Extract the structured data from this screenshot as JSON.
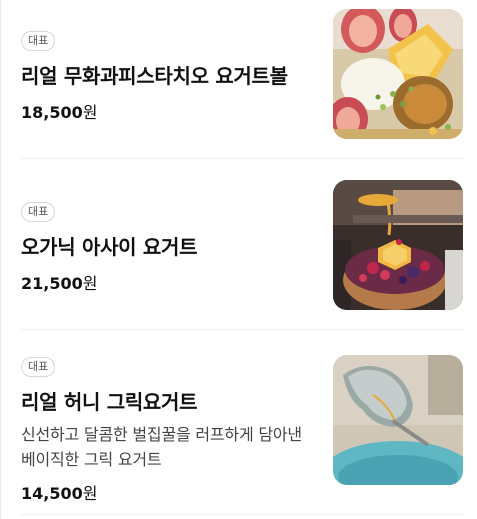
{
  "items": [
    {
      "badge": "대표",
      "name": "리얼 무화과피스타치오 요거트볼",
      "description": "",
      "price": "18,500",
      "currency": "원",
      "image_icon": "fig-pistachio-yogurt-bowl-photo"
    },
    {
      "badge": "대표",
      "name": "오가닉 아사이 요거트",
      "description": "",
      "price": "21,500",
      "currency": "원",
      "image_icon": "acai-yogurt-bowl-photo"
    },
    {
      "badge": "대표",
      "name": "리얼 허니 그릭요거트",
      "description": "신선하고 달콤한 벌집꿀을 러프하게 담아낸 베이직한 그릭 요거트",
      "price": "14,500",
      "currency": "원",
      "image_icon": "greek-yogurt-spoon-photo"
    }
  ]
}
